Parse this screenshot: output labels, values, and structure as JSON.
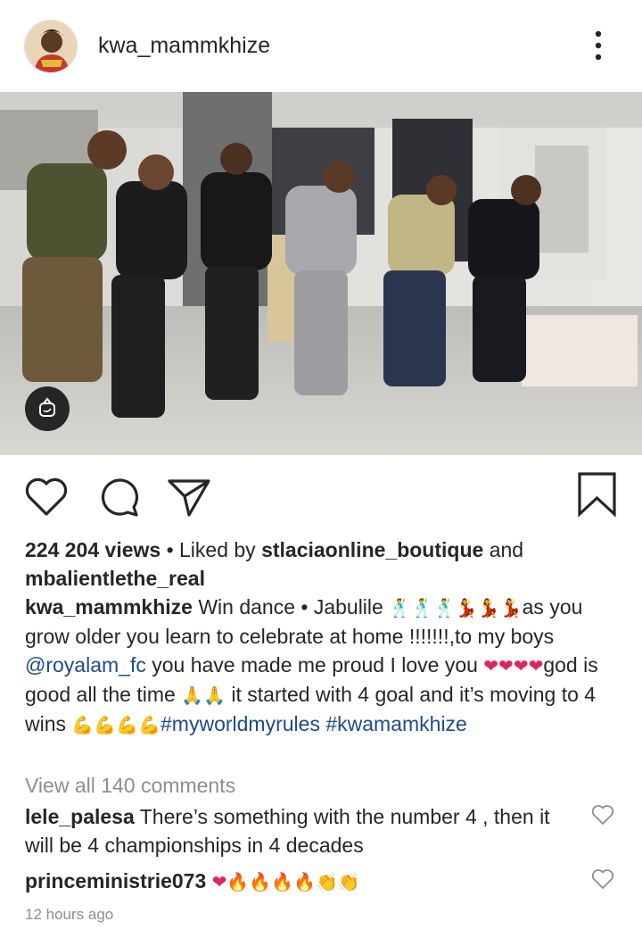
{
  "post": {
    "username": "kwa_mammkhize",
    "views": "224 204 views",
    "liked_by_prefix": "• Liked by",
    "liked_by_user1": "stlaciaonline_boutique",
    "liked_and": "and",
    "liked_by_user2": "mbalientlethe_real",
    "caption": {
      "author": "kwa_mammkhize",
      "p1": "Win dance • Jabulile",
      "e1": "🕺🕺🕺💃💃💃",
      "p2": "as you grow older you learn to celebrate at home !!!!!!!,to my boys",
      "mention": "@royalam_fc",
      "p3": "you have made me proud I love you",
      "e2": "❤❤❤❤",
      "p4": "god is good all the time",
      "e3": "🙏🙏",
      "p5": "it started with 4 goal and it’s moving to 4 wins",
      "e4": "💪💪💪💪",
      "hashtag1": "#myworldmyrules",
      "hashtag2": "#kwamamkhize"
    },
    "view_all_comments": "View all 140 comments",
    "comments": [
      {
        "user": "lele_palesa",
        "text": "There’s something with the number 4 , then it will be 4 championships in 4 decades"
      },
      {
        "user": "princeministrie073",
        "emoji": "❤🔥🔥🔥🔥👏👏"
      }
    ],
    "timestamp": "12 hours ago"
  },
  "colors": {
    "text": "#262626",
    "link": "#1c4b8e",
    "muted": "#8e8e8e"
  },
  "icons": [
    "avatar",
    "more-vertical-icon",
    "mute-icon",
    "heart-icon",
    "comment-icon",
    "share-icon",
    "bookmark-icon"
  ]
}
